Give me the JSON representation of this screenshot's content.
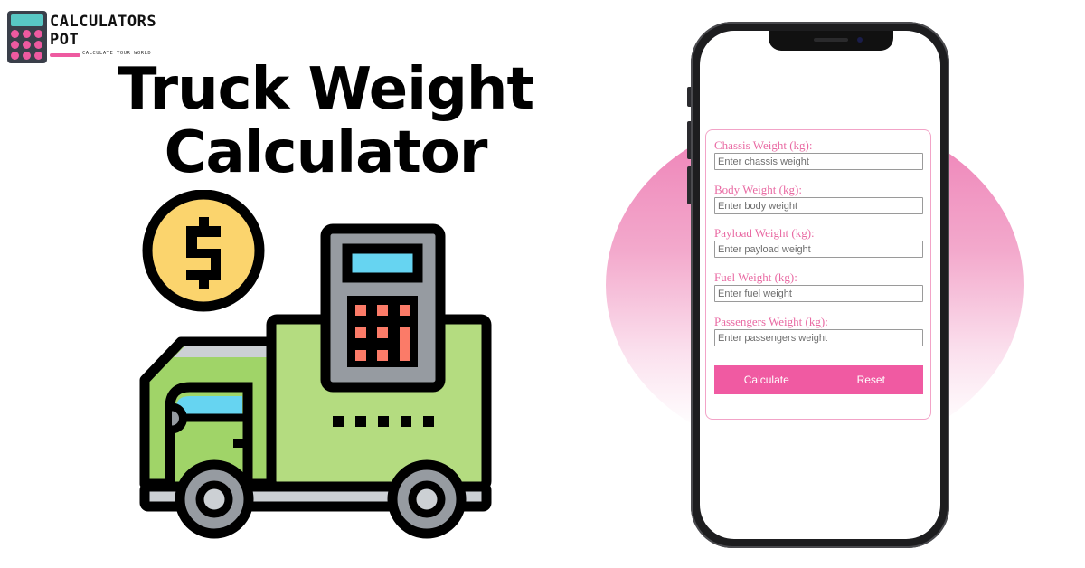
{
  "brand": {
    "name_line1": "CALCULATORS",
    "name_line2": "POT",
    "tagline": "CALCULATE YOUR WORLD",
    "colors": {
      "screen": "#58c7c4",
      "keys": "#ee5aa0",
      "body": "#3a3f4a"
    }
  },
  "hero": {
    "title_line1": "Truck Weight",
    "title_line2": "Calculator"
  },
  "illustration": {
    "icons": [
      "dollar-coin-icon",
      "truck-icon",
      "calculator-icon"
    ],
    "colors": {
      "coin": "#fbd46d",
      "truck": "#b4dc80",
      "cab": "#a0d468",
      "window": "#66d4f1",
      "calc_body": "#969ba1",
      "calc_keys": "#fb7b68",
      "wheel": "#969ba1",
      "chassis": "#ccd0d4"
    }
  },
  "form": {
    "fields": [
      {
        "label": "Chassis Weight (kg):",
        "placeholder": "Enter chassis weight",
        "value": ""
      },
      {
        "label": "Body Weight (kg):",
        "placeholder": "Enter body weight",
        "value": ""
      },
      {
        "label": "Payload Weight (kg):",
        "placeholder": "Enter payload weight",
        "value": ""
      },
      {
        "label": "Fuel Weight (kg):",
        "placeholder": "Enter fuel weight",
        "value": ""
      },
      {
        "label": "Passengers Weight (kg):",
        "placeholder": "Enter passengers weight",
        "value": ""
      }
    ],
    "buttons": {
      "calculate": "Calculate",
      "reset": "Reset"
    },
    "colors": {
      "accent": "#f05aa2",
      "label": "#e96aa3",
      "border": "#f2a3c7"
    }
  }
}
